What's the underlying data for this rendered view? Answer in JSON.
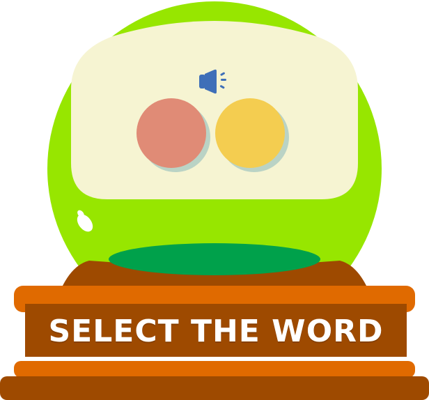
{
  "banner": {
    "label": "SELECT THE WORD"
  },
  "audio_button": {
    "icon": "speaker-icon"
  },
  "choices": [
    {
      "name": "salmon-orb",
      "color": "#e08b76"
    },
    {
      "name": "yellow-orb",
      "color": "#f4cd50"
    }
  ],
  "colors": {
    "globe_rim": "#97e600",
    "globe_screen": "#f6f4d2",
    "base_top": "#00a14b",
    "pedestal_brown": "#9e4a00",
    "pedestal_orange": "#e06a00",
    "speaker": "#3f6fb8"
  }
}
